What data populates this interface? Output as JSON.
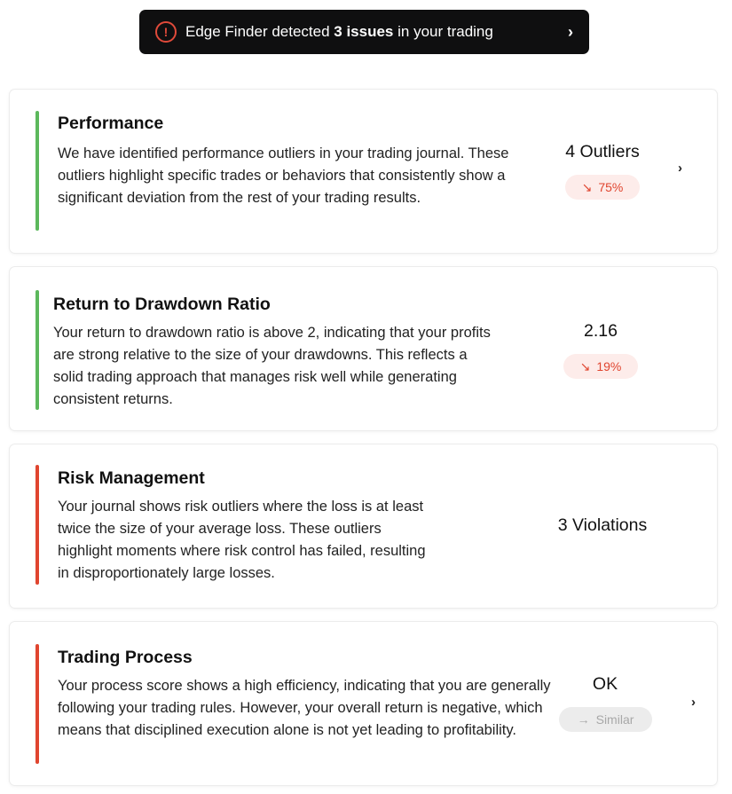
{
  "banner": {
    "prefix": "Edge Finder detected ",
    "highlight": "3 issues",
    "suffix": " in your trading",
    "alert_symbol": "!",
    "chevron": "›"
  },
  "cards": [
    {
      "title": "Performance",
      "description": "We have identified performance outliers in your trading journal. These outliers highlight specific trades or behaviors that consistently show a significant deviation from the rest of your trading results.",
      "metric": "4 Outliers",
      "badge": {
        "arrow": "↘",
        "text": "75%",
        "status": "down"
      },
      "status_color": "#5cb85c",
      "chevron": "›"
    },
    {
      "title": "Return to Drawdown Ratio",
      "description": "Your return to drawdown ratio is above 2, indicating that your profits are strong relative to the size of your drawdowns. This reflects a solid trading approach that manages risk well while generating consistent returns.",
      "metric": "2.16",
      "badge": {
        "arrow": "↘",
        "text": "19%",
        "status": "down"
      },
      "status_color": "#5cb85c"
    },
    {
      "title": "Risk Management",
      "description": "Your journal shows risk outliers where the loss is at least twice the size of your average loss. These outliers highlight moments where risk control has failed, resulting in disproportionately large losses.",
      "metric": "3 Violations",
      "status_color": "#e0452f"
    },
    {
      "title": "Trading Process",
      "description": "Your process score shows a high efficiency, indicating that you are generally following your trading rules. However, your overall return is negative, which means that disciplined execution alone is not yet leading to profitability.",
      "metric": "OK",
      "badge": {
        "arrow": "→",
        "text": "Similar",
        "status": "neutral"
      },
      "status_color": "#e0452f",
      "chevron": "›"
    }
  ],
  "colors": {
    "banner_bg": "#0f0f10",
    "alert": "#e04a3a",
    "positive": "#5cb85c",
    "negative": "#e0452f",
    "badge_down_bg": "#fdecea",
    "badge_neutral_bg": "#ececec"
  }
}
